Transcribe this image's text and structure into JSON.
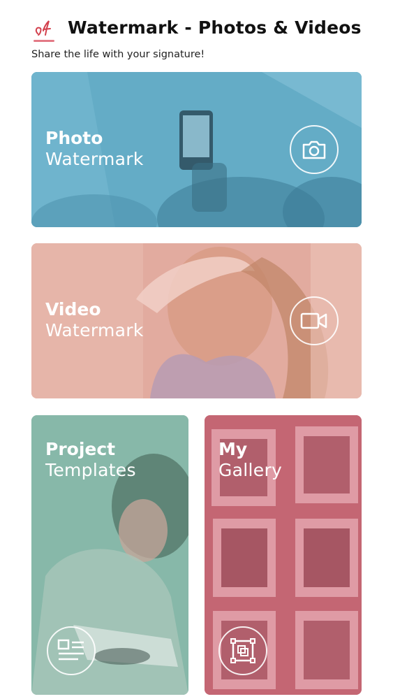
{
  "header": {
    "title": "Watermark - Photos & Videos",
    "subtitle": "Share the life with your signature!",
    "logo_icon": "signature-logo-icon"
  },
  "cards": {
    "photo": {
      "line1": "Photo",
      "line2": "Watermark",
      "icon": "camera-icon",
      "color": "#5fa9c4"
    },
    "video": {
      "line1": "Video",
      "line2": "Watermark",
      "icon": "video-camera-icon",
      "color": "#e0a89c"
    },
    "templates": {
      "line1": "Project",
      "line2": "Templates",
      "icon": "template-list-icon",
      "color": "#84b5a6"
    },
    "gallery": {
      "line1": "My",
      "line2": "Gallery",
      "icon": "gallery-frame-icon",
      "color": "#c26370"
    }
  }
}
